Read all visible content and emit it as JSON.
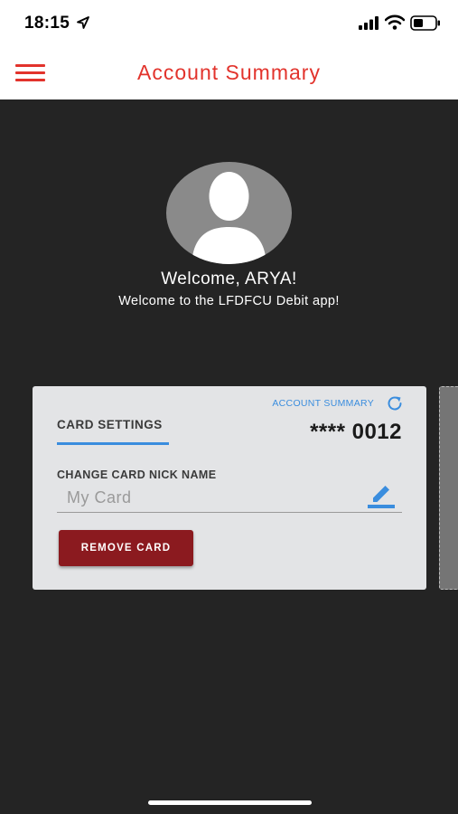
{
  "status_bar": {
    "time": "18:15",
    "icons": [
      "location-arrow-icon",
      "cellular-signal-icon",
      "wifi-icon",
      "battery-icon"
    ]
  },
  "header": {
    "title": "Account Summary",
    "menu_icon": "hamburger-menu-icon"
  },
  "colors": {
    "accent_red": "#e2332c",
    "link_blue": "#3a8dde",
    "button_red": "#8b1a1f",
    "background_dark": "#242424",
    "card_bg": "#e3e4e6"
  },
  "profile": {
    "avatar_icon": "user-silhouette-icon",
    "welcome_title": "Welcome, ARYA!",
    "welcome_subtitle": "Welcome to the LFDFCU Debit app!"
  },
  "card": {
    "account_summary_link": "ACCOUNT SUMMARY",
    "refresh_icon": "refresh-icon",
    "tab_label": "CARD SETTINGS",
    "card_number": "**** 0012",
    "nickname_label": "CHANGE CARD NICK NAME",
    "nickname_placeholder": "My Card",
    "nickname_value": "",
    "edit_icon": "pencil-edit-icon",
    "remove_button_label": "REMOVE CARD"
  }
}
